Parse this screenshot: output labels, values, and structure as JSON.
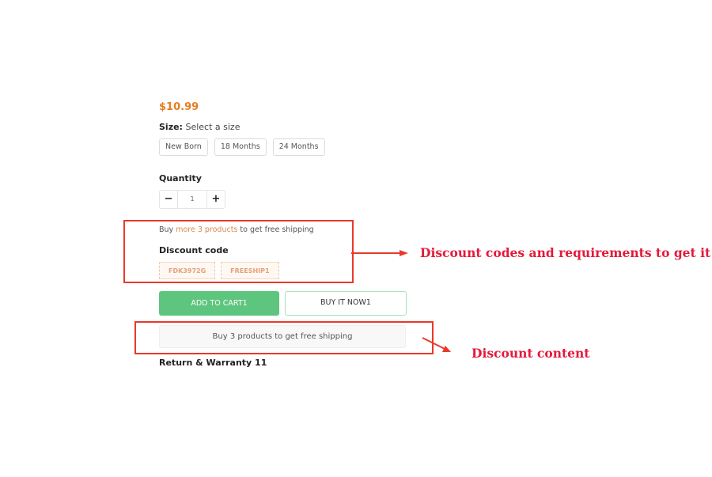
{
  "product": {
    "price": "$10.99",
    "size": {
      "label": "Size:",
      "selected_text": "Select a size",
      "options": [
        "New Born",
        "18 Months",
        "24 Months"
      ]
    },
    "quantity": {
      "label": "Quantity",
      "decrement": "−",
      "value": "1",
      "increment": "+"
    },
    "shipping_note": {
      "prefix": "Buy",
      "highlight": "more 3 products",
      "suffix": "to get free shipping"
    },
    "discount": {
      "label": "Discount code",
      "codes": [
        "FDK3972G",
        "FREESHIP1"
      ]
    },
    "actions": {
      "add_to_cart": "ADD TO CART1",
      "buy_now": "BUY IT NOW1"
    },
    "discount_content": "Buy 3 products to get free shipping",
    "return_warranty": "Return & Warranty 11"
  },
  "annotations": {
    "color": "#e8392b",
    "text_color": "#e5193a",
    "labels": [
      "Discount codes and requirements to get it",
      "Discount content"
    ]
  },
  "colors": {
    "price": "#e67e22",
    "add_to_cart_bg": "#5ec57e",
    "buy_now_border": "#a8e2bb",
    "code_text": "#e3a17a"
  }
}
